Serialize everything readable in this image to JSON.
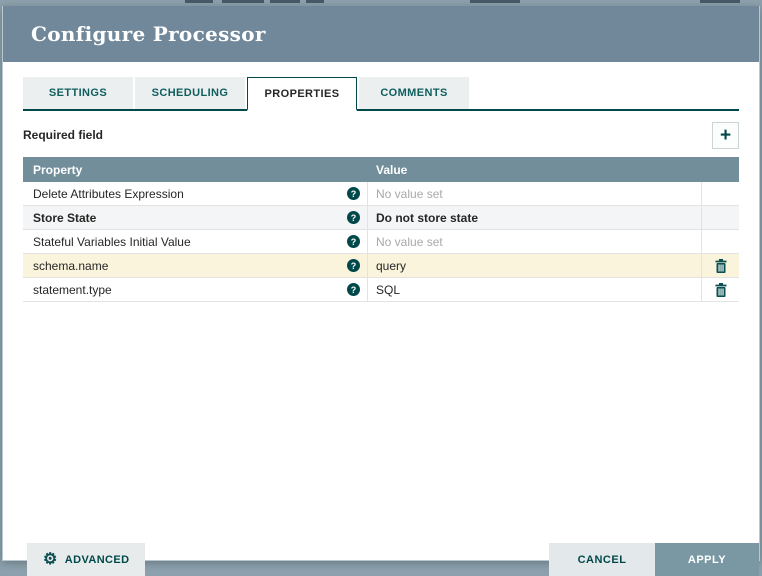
{
  "dialog": {
    "title": "Configure Processor",
    "tabs": [
      {
        "label": "SETTINGS",
        "active": false
      },
      {
        "label": "SCHEDULING",
        "active": false
      },
      {
        "label": "PROPERTIES",
        "active": true
      },
      {
        "label": "COMMENTS",
        "active": false
      }
    ],
    "required_field_label": "Required field",
    "icons": {
      "add": "+",
      "help": "?",
      "gear": "⚙"
    },
    "table": {
      "columns": [
        "Property",
        "Value"
      ],
      "rows": [
        {
          "property": "Delete Attributes Expression",
          "value": "No value set",
          "value_unset": true,
          "bold": false,
          "highlight": "none",
          "deletable": false
        },
        {
          "property": "Store State",
          "value": "Do not store state",
          "value_unset": false,
          "bold": true,
          "highlight": "gray",
          "deletable": false
        },
        {
          "property": "Stateful Variables Initial Value",
          "value": "No value set",
          "value_unset": true,
          "bold": false,
          "highlight": "none",
          "deletable": false
        },
        {
          "property": "schema.name",
          "value": "query",
          "value_unset": false,
          "bold": false,
          "highlight": "yellow",
          "deletable": true
        },
        {
          "property": "statement.type",
          "value": "SQL",
          "value_unset": false,
          "bold": false,
          "highlight": "none",
          "deletable": true
        }
      ]
    },
    "footer": {
      "advanced_label": "ADVANCED",
      "cancel_label": "CANCEL",
      "apply_label": "APPLY"
    },
    "colors": {
      "header_bg": "#71889B",
      "accent_teal": "#004849",
      "table_header_bg": "#728E9B",
      "row_highlight_yellow": "#FBF4DC",
      "row_highlight_gray": "#F4F5F6",
      "apply_bg": "#7A98A3"
    }
  }
}
